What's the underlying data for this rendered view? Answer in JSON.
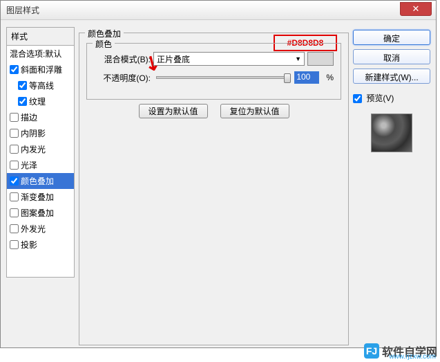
{
  "window": {
    "title": "图层样式",
    "close": "✕"
  },
  "styles": {
    "header": "样式",
    "items": [
      {
        "label": "混合选项:默认",
        "checkbox": false,
        "checked": false,
        "sub": false
      },
      {
        "label": "斜面和浮雕",
        "checkbox": true,
        "checked": true,
        "sub": false
      },
      {
        "label": "等高线",
        "checkbox": true,
        "checked": true,
        "sub": true
      },
      {
        "label": "纹理",
        "checkbox": true,
        "checked": true,
        "sub": true
      },
      {
        "label": "描边",
        "checkbox": true,
        "checked": false,
        "sub": false
      },
      {
        "label": "内阴影",
        "checkbox": true,
        "checked": false,
        "sub": false
      },
      {
        "label": "内发光",
        "checkbox": true,
        "checked": false,
        "sub": false
      },
      {
        "label": "光泽",
        "checkbox": true,
        "checked": false,
        "sub": false
      },
      {
        "label": "颜色叠加",
        "checkbox": true,
        "checked": true,
        "sub": false,
        "selected": true
      },
      {
        "label": "渐变叠加",
        "checkbox": true,
        "checked": false,
        "sub": false
      },
      {
        "label": "图案叠加",
        "checkbox": true,
        "checked": false,
        "sub": false
      },
      {
        "label": "外发光",
        "checkbox": true,
        "checked": false,
        "sub": false
      },
      {
        "label": "投影",
        "checkbox": true,
        "checked": false,
        "sub": false
      }
    ]
  },
  "panel": {
    "outer_title": "颜色叠加",
    "inner_title": "颜色",
    "blend_label": "混合模式(B):",
    "blend_value": "正片叠底",
    "swatch_color": "#D8D8D8",
    "opacity_label": "不透明度(O):",
    "opacity_value": "100",
    "opacity_unit": "%",
    "make_default": "设置为默认值",
    "reset_default": "复位为默认值",
    "highlight_text": "#D8D8D8"
  },
  "buttons": {
    "ok": "确定",
    "cancel": "取消",
    "new_style": "新建样式(W)...",
    "preview_label": "预览(V)"
  },
  "watermark": {
    "logo": "FJ",
    "name": "软件自学网",
    "url": "www.rjzxw.com"
  }
}
